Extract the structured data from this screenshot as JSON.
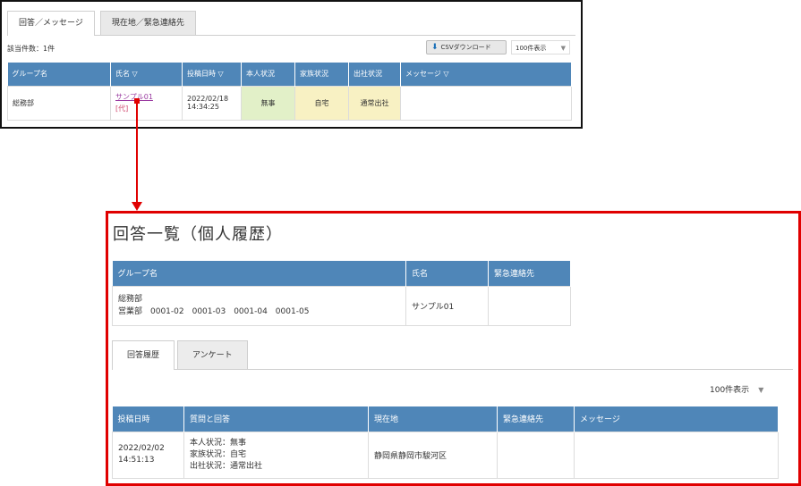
{
  "top": {
    "tabs": [
      {
        "label": "回答／メッセージ"
      },
      {
        "label": "現在地／緊急連絡先"
      }
    ],
    "result_count": "該当件数：1件",
    "csv_label": "CSVダウンロード",
    "per_page": "100件表示",
    "columns": [
      "グループ名",
      "氏名 ▽",
      "投稿日時 ▽",
      "本人状況",
      "家族状況",
      "出社状況",
      "メッセージ ▽"
    ],
    "row": {
      "group": "総務部",
      "name": "サンプル01",
      "name_sub": "[代]",
      "date": "2022/02/18",
      "time": "14:34:25",
      "self_status": "無事",
      "family_status": "自宅",
      "office_status": "通常出社",
      "message": ""
    }
  },
  "detail": {
    "title": "回答一覧（個人履歴）",
    "member_columns": [
      "グループ名",
      "氏名",
      "緊急連絡先"
    ],
    "member_row": {
      "group_line1": "総務部",
      "group_line2": "営業部　0001-02　0001-03　0001-04　0001-05",
      "name": "サンプル01",
      "contact": ""
    },
    "tabs": [
      {
        "label": "回答履歴"
      },
      {
        "label": "アンケート"
      }
    ],
    "per_page": "100件表示",
    "answer_columns": [
      "投稿日時",
      "質問と回答",
      "現在地",
      "緊急連絡先",
      "メッセージ"
    ],
    "answer_row": {
      "date": "2022/02/02",
      "time": "14:51:13",
      "qa_line1": "本人状況：無事",
      "qa_line2": "家族状況：自宅",
      "qa_line3": "出社状況：通常出社",
      "location": "静岡県静岡市駿河区",
      "contact": "",
      "message": ""
    }
  },
  "colors": {
    "header_blue": "#4f86b8",
    "status_green": "#e2f0c8",
    "status_yellow": "#f8f1c3",
    "highlight_red": "#e00000",
    "link_purple": "#9a3aa0"
  }
}
